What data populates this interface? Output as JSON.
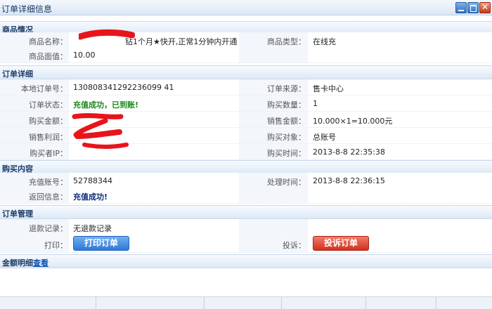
{
  "window": {
    "title": "订单详细信息"
  },
  "sections": {
    "product": "商品情况",
    "order": "订单详细",
    "purchase": "购买内容",
    "manage": "订单管理",
    "amount": "金额明细",
    "amount_link": "查看"
  },
  "product": {
    "name_label": "商品名称：",
    "name_value": "钻1个月★快开,正常1分钟内开通",
    "type_label": "商品类型：",
    "type_value": "在线充",
    "face_label": "商品面值：",
    "face_value": "10.00"
  },
  "order": {
    "local_no_label": "本地订单号：",
    "local_no_value": "130808341292236099 41",
    "source_label": "订单来源：",
    "source_value": "售卡中心",
    "status_label": "订单状态：",
    "status_value": "充值成功，已到账!",
    "qty_label": "购买数量：",
    "qty_value": "1",
    "amount_label": "购买金额：",
    "sale_label": "销售金额：",
    "sale_value": "10.000×1=10.000元",
    "profit_label": "销售利润：",
    "buyer_label": "购买对象：",
    "buyer_value": "总账号",
    "ip_label": "购买者IP：",
    "time_label": "购买时间：",
    "time_value": "2013-8-8 22:35:38"
  },
  "purchase": {
    "account_label": "充值账号：",
    "account_value": "52788344",
    "proc_label": "处理时间：",
    "proc_value": "2013-8-8 22:36:15",
    "return_label": "返回信息：",
    "return_value": "充值成功!"
  },
  "manage": {
    "refund_label": "退款记录：",
    "refund_value": "无退款记录",
    "print_label": "打印：",
    "print_button": "打印订单",
    "complain_label": "投诉：",
    "complain_button": "投诉订单"
  }
}
